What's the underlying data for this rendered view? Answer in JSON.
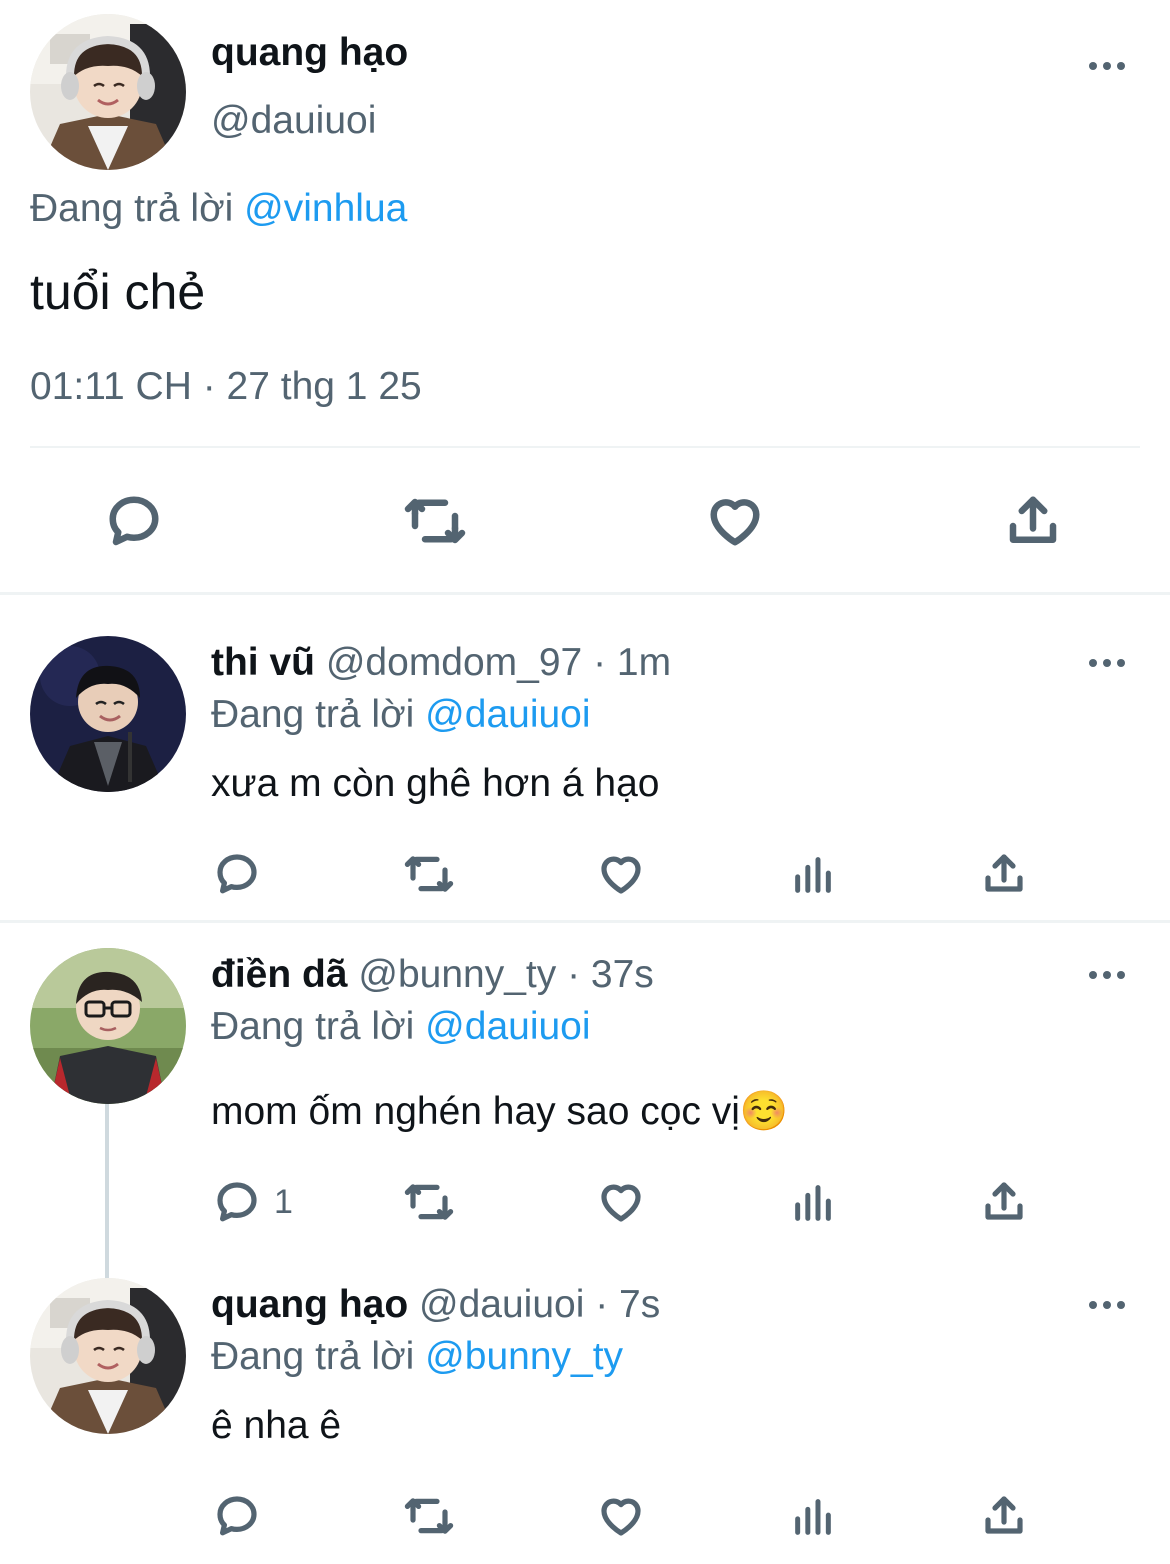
{
  "main_tweet": {
    "display_name": "quang hạo",
    "handle": "@dauiuoi",
    "reply_prefix": "Đang trả lời",
    "reply_to": "@vinhlua",
    "text": "tuổi chẻ",
    "timestamp": "01:11 CH · 27 thg 1 25",
    "actions": [
      "reply-icon",
      "retweet-icon",
      "like-icon",
      "share-icon"
    ]
  },
  "replies": [
    {
      "display_name": "thi vũ",
      "handle": "@domdom_97",
      "time": "· 1m",
      "reply_prefix": "Đang trả lời",
      "reply_to": "@dauiuoi",
      "text": "xưa m còn ghê hơn á hạo",
      "reply_count": ""
    },
    {
      "display_name": "điền dã",
      "handle": "@bunny_ty",
      "time": "· 37s",
      "reply_prefix": "Đang trả lời",
      "reply_to": "@dauiuoi",
      "text": "mom ốm nghén hay sao cọc vị",
      "emoji": "☺️",
      "reply_count": "1"
    },
    {
      "display_name": "quang hạo",
      "handle": "@dauiuoi",
      "time": "· 7s",
      "reply_prefix": "Đang trả lời",
      "reply_to": "@bunny_ty",
      "text": "ê nha ê",
      "reply_count": ""
    }
  ],
  "colors": {
    "text": "#0f1419",
    "secondary": "#536471",
    "accent": "#1d9bf0",
    "divider": "#eff3f4",
    "thread_line": "#cfd9de"
  }
}
